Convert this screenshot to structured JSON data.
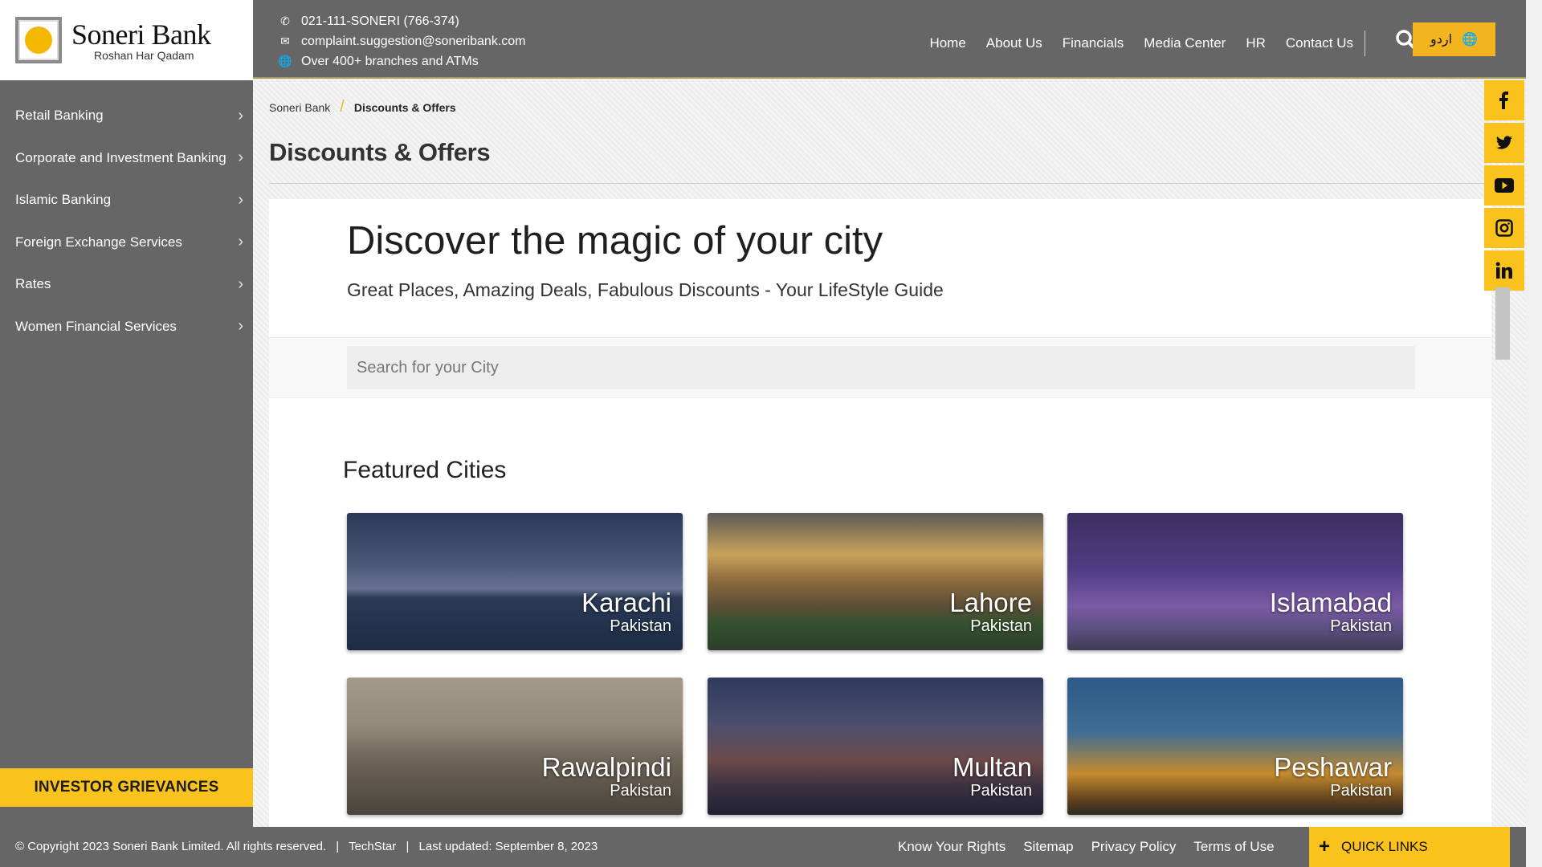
{
  "brand": {
    "name": "Soneri Bank",
    "tagline": "Roshan Har Qadam",
    "accent_color": "#f9c21c",
    "dark_color": "#666666"
  },
  "contact": {
    "phone": "021-111-SONERI (766-374)",
    "email": "complaint.suggestion@soneribank.com",
    "branches": "Over 400+ branches and ATMs"
  },
  "topnav": {
    "items": [
      "Home",
      "About Us",
      "Financials",
      "Media Center",
      "HR",
      "Contact Us"
    ],
    "language_button": "اردو",
    "search_icon": "search-icon",
    "globe_icon": "globe-icon"
  },
  "sidebar": {
    "items": [
      {
        "label": "Retail Banking"
      },
      {
        "label": "Corporate and Investment Banking"
      },
      {
        "label": "Islamic Banking"
      },
      {
        "label": "Foreign Exchange Services"
      },
      {
        "label": "Rates"
      },
      {
        "label": "Women Financial Services"
      }
    ],
    "investor_button": "INVESTOR GRIEVANCES"
  },
  "breadcrumb": {
    "home": "Soneri Bank",
    "current": "Discounts & Offers"
  },
  "page": {
    "title": "Discounts & Offers",
    "hero_title": "Discover the magic of your city",
    "hero_subtitle": "Great Places, Amazing Deals, Fabulous Discounts - Your LifeStyle Guide",
    "search_placeholder": "Search for your City",
    "featured_heading": "Featured Cities"
  },
  "cities": [
    {
      "name": "Karachi",
      "country": "Pakistan"
    },
    {
      "name": "Lahore",
      "country": "Pakistan"
    },
    {
      "name": "Islamabad",
      "country": "Pakistan"
    },
    {
      "name": "Rawalpindi",
      "country": "Pakistan"
    },
    {
      "name": "Multan",
      "country": "Pakistan"
    },
    {
      "name": "Peshawar",
      "country": "Pakistan"
    }
  ],
  "social": [
    "facebook-icon",
    "twitter-icon",
    "youtube-icon",
    "instagram-icon",
    "linkedin-icon"
  ],
  "footer": {
    "copyright": "© Copyright 2023 Soneri Bank Limited. All rights reserved.",
    "credit": "TechStar",
    "updated": "Last updated: September 8, 2023",
    "links": [
      "Know Your Rights",
      "Sitemap",
      "Privacy Policy",
      "Terms of Use"
    ],
    "quick_links": "QUICK LINKS"
  }
}
